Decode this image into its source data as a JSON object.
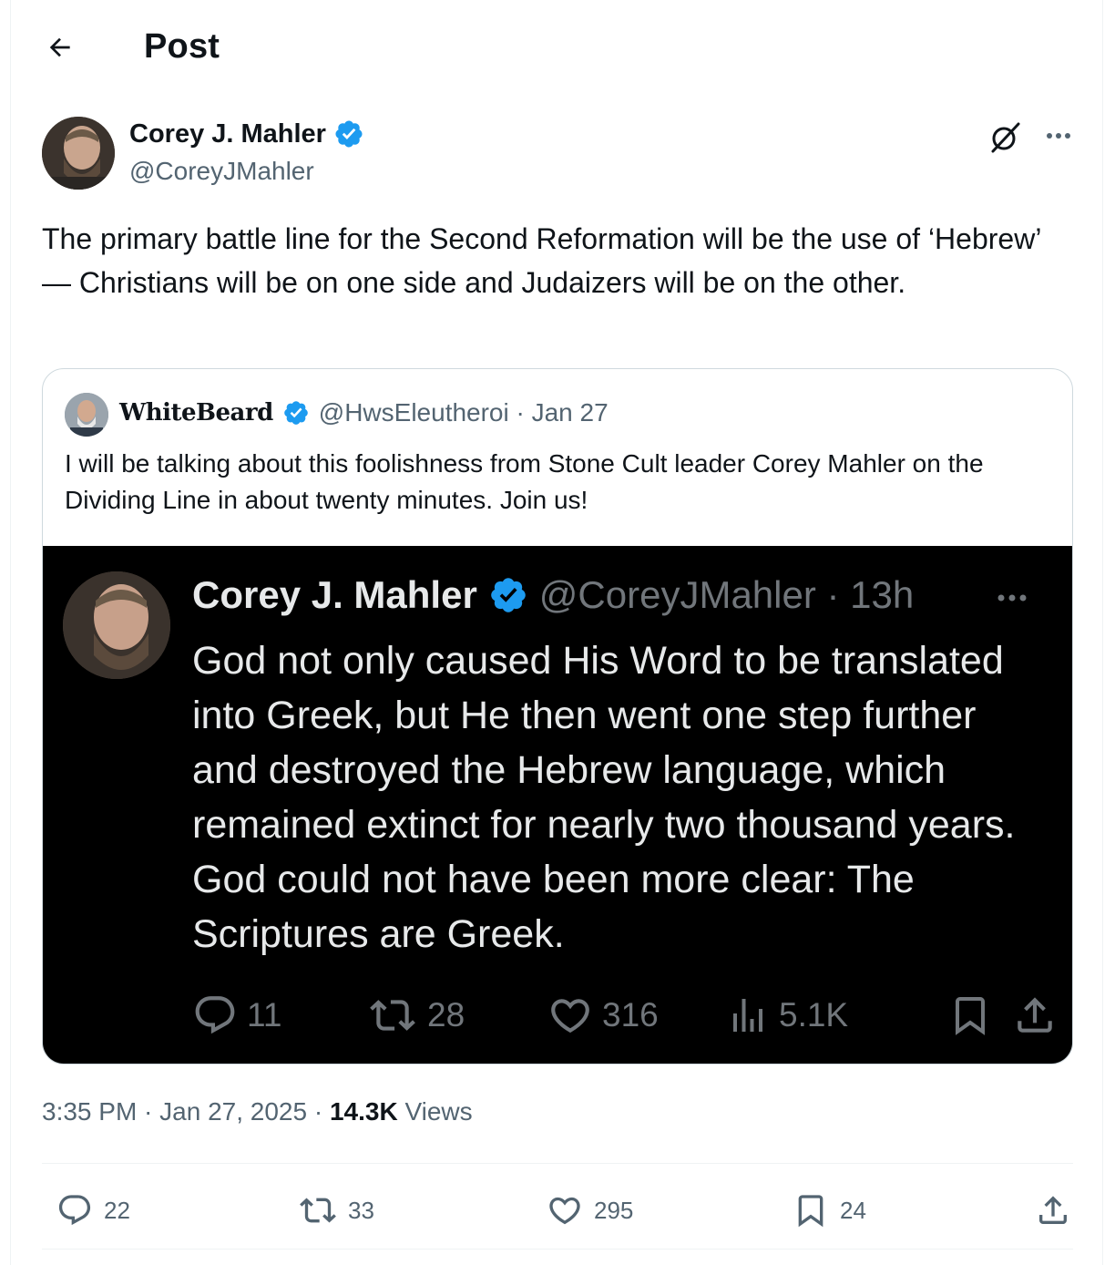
{
  "header": {
    "title": "Post",
    "back_icon": "arrow-left-icon"
  },
  "post": {
    "author_name": "Corey J. Mahler",
    "author_handle": "@CoreyJMahler",
    "verified_color": "#1d9bf0",
    "text": "The primary battle line for the Second Reformation will be the use of ‘Hebrew’ — Christians will be on one side and Judaizers will be on the other.",
    "timestamp": "3:35 PM · Jan 27, 2025 · ",
    "views_count": "14.3K",
    "views_label": " Views",
    "replies": "22",
    "reposts": "33",
    "likes": "295",
    "bookmarks": "24"
  },
  "quote": {
    "author_name": "WhiteBeard",
    "handle_date": "@HwsEleutheroi · Jan 27",
    "text": "I will be talking about this foolishness from Stone Cult leader Corey Mahler on the Dividing Line in about twenty minutes.  Join us!",
    "screenshot": {
      "author_name": "Corey J. Mahler",
      "handle_time": "@CoreyJMahler · 13h",
      "text": "God not only caused His Word to be translated into Greek, but He then went one step further and destroyed the Hebrew language, which remained extinct for nearly two thousand years. God could not have been more clear: The Scriptures are Greek.",
      "replies": "11",
      "reposts": "28",
      "likes": "316",
      "views": "5.1K"
    }
  }
}
